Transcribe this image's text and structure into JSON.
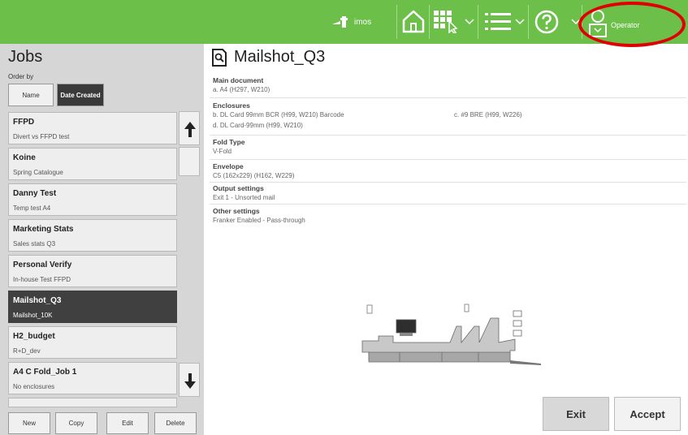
{
  "topbar": {
    "brand_label": "imos",
    "operator_label": "Operator",
    "icons": [
      "home-icon",
      "job-select-icon",
      "chevron-down-icon",
      "list-icon",
      "chevron-down-icon",
      "help-icon",
      "chevron-down-icon",
      "operator-icon"
    ]
  },
  "jobs": {
    "title": "Jobs",
    "order_by_label": "Order by",
    "sort_name": "Name",
    "sort_date": "Date Created",
    "items": [
      {
        "title": "FFPD",
        "subtitle": "Divert vs FFPD test"
      },
      {
        "title": "Koine",
        "subtitle": "Spring Catalogue"
      },
      {
        "title": "Danny Test",
        "subtitle": "Temp test A4"
      },
      {
        "title": "Marketing Stats",
        "subtitle": "Sales stats Q3"
      },
      {
        "title": "Personal Verify",
        "subtitle": "In-house Test FFPD"
      },
      {
        "title": "Mailshot_Q3",
        "subtitle": "Mailshot_10K"
      },
      {
        "title": "H2_budget",
        "subtitle": "R+D_dev"
      },
      {
        "title": "A4 C Fold_Job 1",
        "subtitle": "No enclosures"
      }
    ],
    "selected_index": 5,
    "buttons": {
      "new": "New",
      "copy": "Copy",
      "edit": "Edit",
      "delete": "Delete"
    }
  },
  "detail": {
    "title": "Mailshot_Q3",
    "main_document": {
      "heading": "Main document",
      "value": "a. A4 (H297, W210)"
    },
    "enclosures": {
      "heading": "Enclosures",
      "items": [
        "b. DL Card 99mm BCR (H99, W210) Barcode",
        "c. #9 BRE (H99, W226)",
        "d. DL Card-99mm (H99, W210)"
      ]
    },
    "fold_type": {
      "heading": "Fold Type",
      "value": "V-Fold"
    },
    "envelope": {
      "heading": "Envelope",
      "value": "C5 (162x229) (H162, W229)"
    },
    "output_settings": {
      "heading": "Output settings",
      "value": "Exit 1 - Unsorted mail"
    },
    "other_settings": {
      "heading": "Other settings",
      "value": "Franker Enabled - Pass-through"
    }
  },
  "actions": {
    "exit": "Exit",
    "accept": "Accept"
  },
  "colors": {
    "topbar": "#6cc04a",
    "selected_job": "#404040",
    "highlight_ring": "#e00000"
  }
}
